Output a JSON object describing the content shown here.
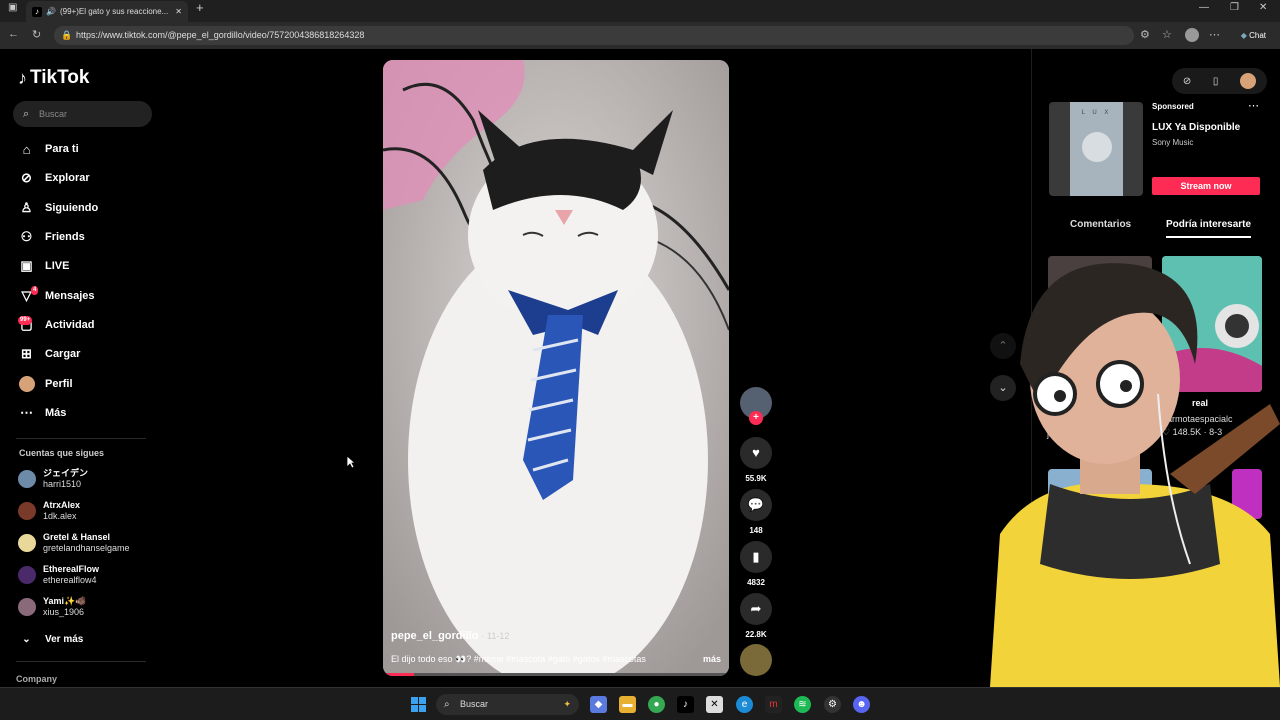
{
  "browser": {
    "tab_title": "(99+)El gato y sus reaccione...",
    "tab_icon": "tiktok-icon",
    "new_tab": "+",
    "url": "https://www.tiktok.com/@pepe_el_gordillo/video/7572004386818264328",
    "chat_label": "Chat"
  },
  "sidebar": {
    "logo": "TikTok",
    "search_placeholder": "Buscar",
    "nav": [
      {
        "label": "Para ti",
        "icon": "home-icon"
      },
      {
        "label": "Explorar",
        "icon": "compass-icon"
      },
      {
        "label": "Siguiendo",
        "icon": "user-follow-icon"
      },
      {
        "label": "Friends",
        "icon": "friends-icon"
      },
      {
        "label": "LIVE",
        "icon": "live-tv-icon"
      },
      {
        "label": "Mensajes",
        "icon": "send-icon",
        "badge": "4"
      },
      {
        "label": "Actividad",
        "icon": "inbox-icon",
        "badge": "99+"
      },
      {
        "label": "Cargar",
        "icon": "upload-icon"
      },
      {
        "label": "Perfil",
        "icon": "avatar"
      },
      {
        "label": "Más",
        "icon": "more-icon"
      }
    ],
    "following_title": "Cuentas que sigues",
    "following": [
      {
        "name": "ジェイデン",
        "handle": "harri1510",
        "color": "#6d8aa8"
      },
      {
        "name": "AtrxAlex",
        "handle": "1dk.alex",
        "color": "#7a3a2a"
      },
      {
        "name": "Gretel & Hansel",
        "handle": "gretelandhanselgame",
        "color": "#e8d89a"
      },
      {
        "name": "EtherealFlow",
        "handle": "etherealflow4",
        "color": "#4a2a6a"
      },
      {
        "name": "Yami✨🐗",
        "handle": "xius_1906",
        "color": "#8a6a7a"
      }
    ],
    "see_more": "Ver más",
    "company": "Company"
  },
  "video": {
    "username": "pepe_el_gordillo",
    "date": "· 11-12",
    "caption": "El dijo todo eso 👀? #meme #mascota #gato #gatos #mascotas",
    "more": "más",
    "progress": 0.09
  },
  "actions": {
    "likes": "55.9K",
    "comments": "148",
    "saves": "4832",
    "shares": "22.8K"
  },
  "right": {
    "ad": {
      "sponsored": "Sponsored",
      "cd_text": "L U X",
      "title": "LUX Ya Disponible",
      "subtitle": "Sony Music",
      "cta": "Stream now"
    },
    "tabs": [
      "Comentarios",
      "Podría interesarte"
    ],
    "suggestions": [
      {
        "title": "real",
        "user": "armotaespacialc",
        "likes": "148.5K",
        "date": "8-3"
      }
    ],
    "partial_user": "ja"
  },
  "taskbar": {
    "search": "Buscar"
  }
}
